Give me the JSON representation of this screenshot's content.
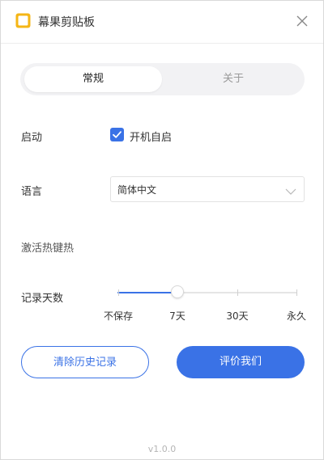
{
  "window": {
    "title": "幕果剪贴板"
  },
  "colors": {
    "accent": "#3a72e6",
    "icon_yellow": "#f5b616"
  },
  "icons": {
    "app": "clipboard-app-icon",
    "close": "close-icon",
    "check": "check-icon",
    "dropdown": "chevron-down-icon"
  },
  "tabs": [
    {
      "label": "常规",
      "active": true
    },
    {
      "label": "关于",
      "active": false
    }
  ],
  "settings": {
    "startup": {
      "label": "启动",
      "checkbox_label": "开机自启",
      "checked": true
    },
    "language": {
      "label": "语言",
      "value": "简体中文"
    },
    "hotkey": {
      "label": "激活热键热"
    },
    "history_days": {
      "label": "记录天数",
      "marks": [
        "不保存",
        "7天",
        "30天",
        "永久"
      ],
      "selected_index": 1,
      "selected": "7天"
    }
  },
  "actions": {
    "clear_history": "清除历史记录",
    "rate_us": "评价我们"
  },
  "footer": {
    "version": "v1.0.0"
  }
}
